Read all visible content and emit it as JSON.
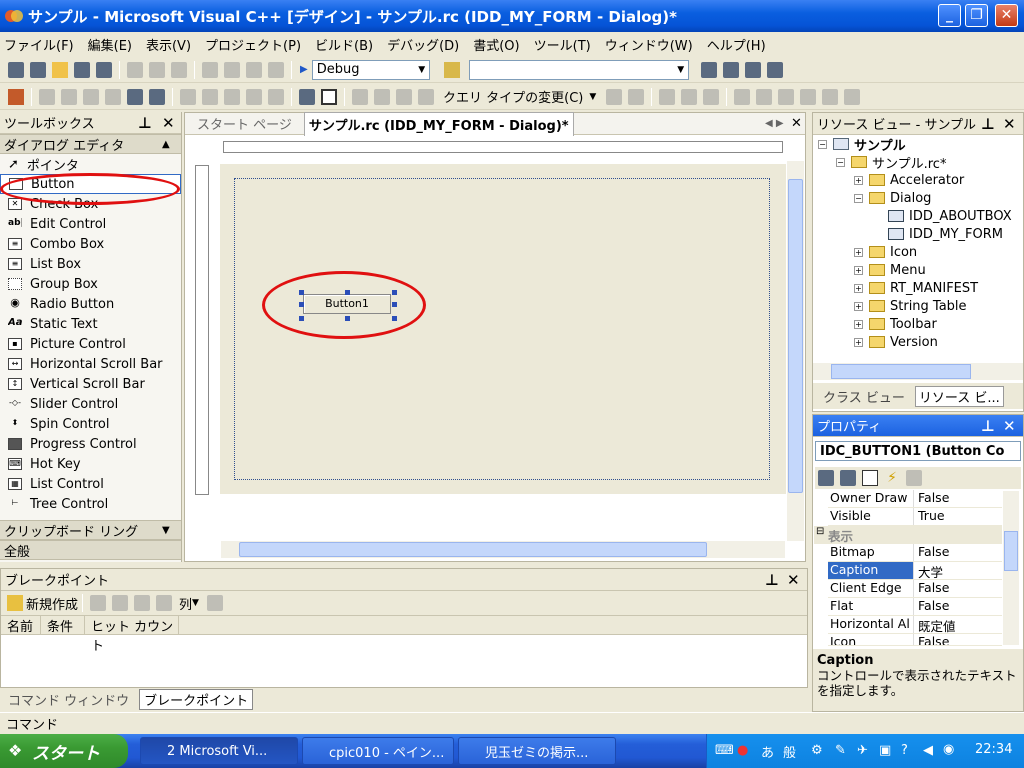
{
  "window": {
    "title": "サンプル - Microsoft Visual C++ [デザイン] - サンプル.rc (IDD_MY_FORM - Dialog)*"
  },
  "menu": [
    "ファイル(F)",
    "編集(E)",
    "表示(V)",
    "プロジェクト(P)",
    "ビルド(B)",
    "デバッグ(D)",
    "書式(O)",
    "ツール(T)",
    "ウィンドウ(W)",
    "ヘルプ(H)"
  ],
  "toolbar": {
    "config": "Debug",
    "query_type": "クエリ タイプの変更(C)"
  },
  "toolbox": {
    "title": "ツールボックス",
    "category": "ダイアログ エディタ",
    "items": [
      "ポインタ",
      "Button",
      "Check Box",
      "Edit Control",
      "Combo Box",
      "List Box",
      "Group Box",
      "Radio Button",
      "Static Text",
      "Picture Control",
      "Horizontal Scroll Bar",
      "Vertical Scroll Bar",
      "Slider Control",
      "Spin Control",
      "Progress Control",
      "Hot Key",
      "List Control",
      "Tree Control"
    ],
    "clipboard": "クリップボード リング",
    "general": "全般"
  },
  "editor": {
    "tabs": [
      "スタート ページ",
      "サンプル.rc (IDD_MY_FORM - Dialog)*"
    ],
    "button_caption": "Button1"
  },
  "resview": {
    "title": "リソース ビュー - サンプル",
    "tree": [
      "サンプル",
      "サンプル.rc*",
      "Accelerator",
      "Dialog",
      "IDD_ABOUTBOX",
      "IDD_MY_FORM",
      "Icon",
      "Menu",
      "RT_MANIFEST",
      "String Table",
      "Toolbar",
      "Version"
    ],
    "tabs": [
      "クラス ビュー",
      "リソース ビ..."
    ]
  },
  "properties": {
    "title": "プロパティ",
    "object": "IDC_BUTTON1 (Button Co",
    "rows": [
      {
        "name": "Owner Draw",
        "value": "False"
      },
      {
        "name": "Visible",
        "value": "True"
      },
      {
        "name": "表示",
        "value": ""
      },
      {
        "name": "Bitmap",
        "value": "False"
      },
      {
        "name": "Caption",
        "value": "大学"
      },
      {
        "name": "Client Edge",
        "value": "False"
      },
      {
        "name": "Flat",
        "value": "False"
      },
      {
        "name": "Horizontal Al",
        "value": "既定値"
      },
      {
        "name": "Icon",
        "value": "False"
      }
    ],
    "desc_title": "Caption",
    "desc_text": "コントロールで表示されたテキストを指定します。"
  },
  "breakpoints": {
    "title": "ブレークポイント",
    "new": "新規作成",
    "columns_btn": "列",
    "headers": [
      "名前",
      "条件",
      "ヒット カウント"
    ],
    "tabs": [
      "コマンド ウィンドウ",
      "ブレークポイント"
    ]
  },
  "status": {
    "text": "コマンド"
  },
  "taskbar": {
    "start": "スタート",
    "tasks": [
      "2 Microsoft Vi...",
      "cpic010 - ペイン...",
      "児玉ゼミの掲示..."
    ],
    "ime": [
      "あ",
      "般"
    ],
    "clock": "22:34"
  }
}
